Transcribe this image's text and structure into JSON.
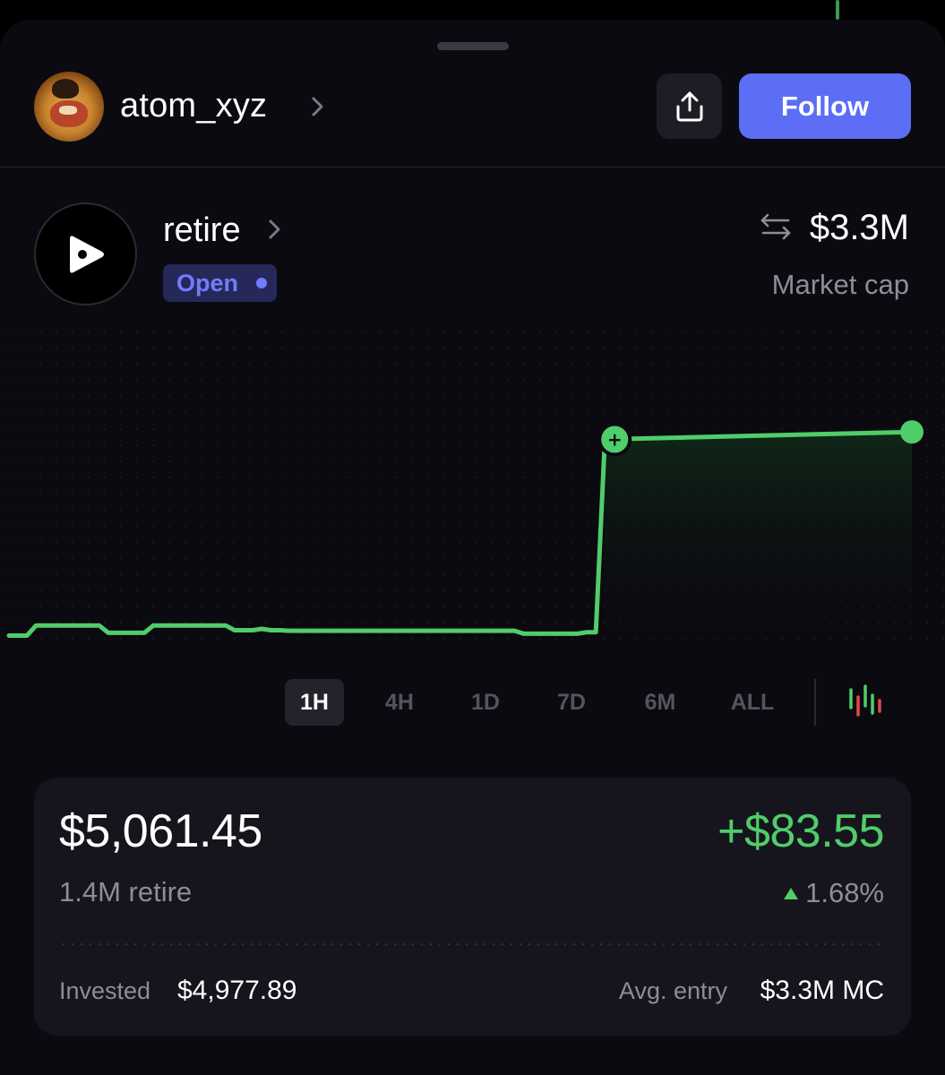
{
  "profile": {
    "username": "atom_xyz",
    "follow_label": "Follow",
    "share_icon": "share-icon",
    "chevron_icon": "chevron-right-icon"
  },
  "token": {
    "name": "retire",
    "status": "Open",
    "market_cap": "$3.3M",
    "market_cap_label": "Market cap",
    "logo_icon": "play-icon",
    "swap_icon": "swap-arrows-icon"
  },
  "timeframes": {
    "items": [
      "1H",
      "4H",
      "1D",
      "7D",
      "6M",
      "ALL"
    ],
    "selected": "1H",
    "candle_icon": "candlestick-chart-icon"
  },
  "chart_data": {
    "type": "line",
    "x": [
      0,
      2,
      3,
      5,
      10,
      11,
      15,
      16,
      24,
      25,
      27,
      28,
      29,
      30,
      31,
      56,
      57,
      63,
      64,
      65,
      66,
      100
    ],
    "values": [
      4.73,
      4.73,
      5.68,
      5.68,
      5.68,
      4.99,
      4.99,
      5.68,
      5.68,
      5.23,
      5.23,
      5.36,
      5.23,
      5.23,
      5.18,
      5.18,
      4.91,
      4.91,
      5.04,
      5.04,
      23.2,
      23.9
    ],
    "series_color": "#4fcd6a",
    "grid": true,
    "markers": [
      "buy-marker",
      "current-price-marker"
    ]
  },
  "position": {
    "value": "$5,061.45",
    "amount": "1.4M retire",
    "pnl": "+$83.55",
    "pnl_pct": "1.68%",
    "invested_label": "Invested",
    "invested_value": "$4,977.89",
    "avg_entry_label": "Avg. entry",
    "avg_entry_value": "$3.3M MC",
    "up_color": "#4fcd6a"
  }
}
